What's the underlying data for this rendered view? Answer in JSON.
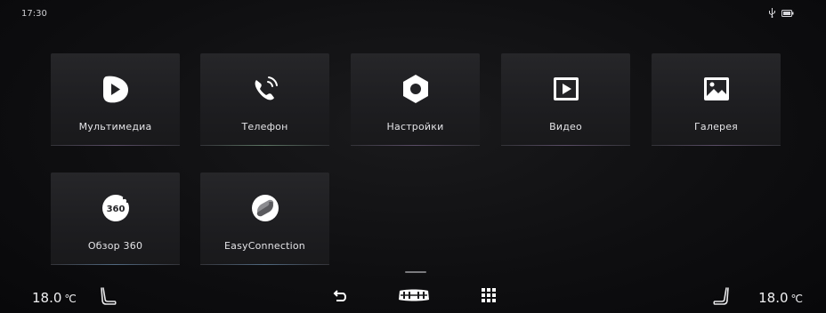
{
  "status": {
    "time": "17:30",
    "icons": [
      "usb-icon",
      "battery-icon"
    ]
  },
  "apps": [
    {
      "label": "Мультимедиа",
      "icon": "multimedia-icon"
    },
    {
      "label": "Телефон",
      "icon": "phone-icon"
    },
    {
      "label": "Настройки",
      "icon": "settings-hex-icon"
    },
    {
      "label": "Видео",
      "icon": "video-play-icon"
    },
    {
      "label": "Галерея",
      "icon": "gallery-image-icon"
    },
    {
      "label": "Обзор 360",
      "icon": "view-360-icon"
    },
    {
      "label": "EasyConnection",
      "icon": "easyconnection-icon"
    }
  ],
  "climate": {
    "driver_temp": "18.0",
    "passenger_temp": "18.0",
    "unit": "℃"
  },
  "bottom_controls": [
    "driver-seat-icon",
    "back-icon",
    "car-home-icon",
    "app-grid-icon",
    "passenger-seat-icon"
  ],
  "colors": {
    "background": "#0f0f11",
    "tile": "#232326",
    "text": "#e8e8ea"
  }
}
